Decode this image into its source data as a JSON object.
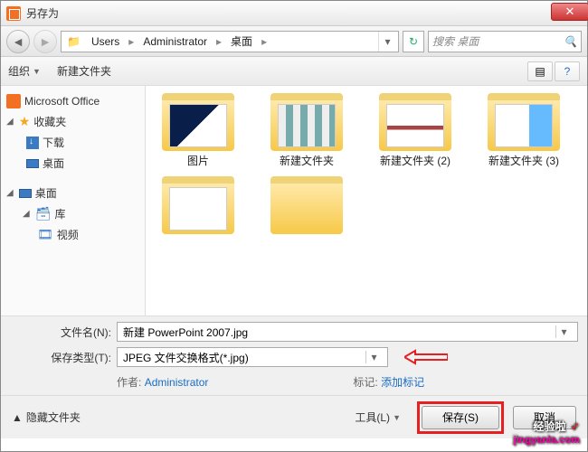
{
  "title": "另存为",
  "nav": {
    "back": "◄",
    "fwd": "►"
  },
  "breadcrumb": [
    "Users",
    "Administrator",
    "桌面"
  ],
  "search_placeholder": "搜索 桌面",
  "toolbar": {
    "organize": "组织",
    "newfolder": "新建文件夹"
  },
  "sidebar": {
    "msoffice": "Microsoft Office",
    "favorites": "收藏夹",
    "downloads": "下载",
    "desktop": "桌面",
    "desktop2": "桌面",
    "library": "库",
    "videos": "视频"
  },
  "files": [
    {
      "name": "图片",
      "thumb": "thumb1"
    },
    {
      "name": "新建文件夹",
      "thumb": "thumb2"
    },
    {
      "name": "新建文件夹 (2)",
      "thumb": "thumb3"
    },
    {
      "name": "新建文件夹 (3)",
      "thumb": "thumb4"
    },
    {
      "name": "",
      "thumb": "thumb5"
    },
    {
      "name": "",
      "thumb": ""
    }
  ],
  "form": {
    "filename_label": "文件名(N):",
    "filename_value": "新建 PowerPoint 2007.jpg",
    "filetype_label": "保存类型(T):",
    "filetype_value": "JPEG 文件交换格式(*.jpg)",
    "author_label": "作者:",
    "author_value": "Administrator",
    "tag_label": "标记:",
    "tag_value": "添加标记"
  },
  "footer": {
    "hide_folders": "隐藏文件夹",
    "tools": "工具(L)",
    "save": "保存(S)",
    "cancel": "取消"
  },
  "watermark": {
    "line1": "经验啦",
    "line2": "jingyanla.com",
    "check": "✓"
  }
}
